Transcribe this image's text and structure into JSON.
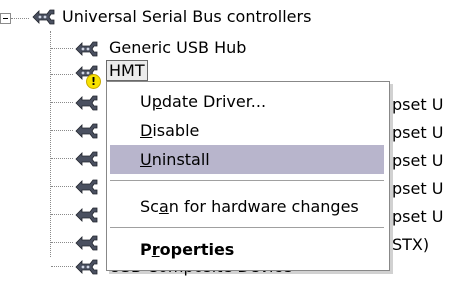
{
  "tree": {
    "root": {
      "label": "Universal Serial Bus controllers",
      "icon": "usb-icon"
    },
    "children": [
      {
        "label": "Generic USB Hub",
        "icon": "usb-icon"
      },
      {
        "label": "HMT",
        "icon": "usb-icon",
        "selected": true,
        "warning": "!"
      },
      {
        "label": "",
        "icon": "usb-icon"
      },
      {
        "label": "",
        "icon": "usb-icon"
      },
      {
        "label": "",
        "icon": "usb-icon"
      },
      {
        "label": "",
        "icon": "usb-icon"
      },
      {
        "label": "",
        "icon": "usb-icon"
      },
      {
        "label": "",
        "icon": "usb-icon"
      },
      {
        "label": "USB Composite Device",
        "icon": "usb-icon"
      }
    ],
    "partial_labels": [
      "pset U",
      "pset U",
      "pset U",
      "pset U",
      "pset U",
      "STX)"
    ]
  },
  "context_menu": {
    "items": [
      {
        "label": "Update Driver...",
        "mnemonic_index": 1
      },
      {
        "label": "Disable",
        "mnemonic_index": 0
      },
      {
        "label": "Uninstall",
        "mnemonic_index": 0,
        "highlighted": true
      },
      {
        "label": "Scan for hardware changes",
        "mnemonic_index": 2
      },
      {
        "label": "Properties",
        "mnemonic_index": 1,
        "bold": true
      }
    ]
  },
  "colors": {
    "menu_highlight": "#b8b5cc",
    "warning": "#f7e200"
  }
}
